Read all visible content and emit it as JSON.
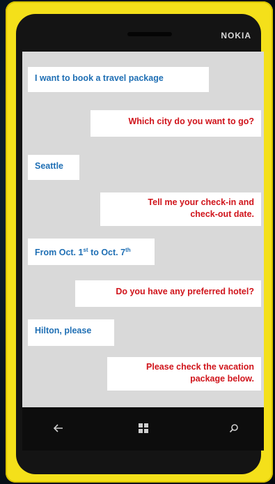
{
  "phone": {
    "brand": "NOKIA"
  },
  "chat": {
    "m1": "I want to book a travel package",
    "m2": "Which city do you want to go?",
    "m3": "Seattle",
    "m4_line1": "Tell me your check-in and",
    "m4_line2": "check-out date.",
    "m5_a": "From Oct. 1",
    "m5_sup1": "st",
    "m5_b": " to Oct. 7",
    "m5_sup2": "th",
    "m6": "Do you have any preferred hotel?",
    "m7": "Hilton, please",
    "m8_line1": "Please check the vacation",
    "m8_line2": "package below."
  },
  "navbar": {
    "back_icon": "back-arrow-icon",
    "home_icon": "windows-logo-icon",
    "search_icon": "search-icon"
  },
  "colors": {
    "phone_body": "#f4e01a",
    "user_text": "#1f6fb4",
    "bot_text": "#d0141b",
    "screen_bg": "#d9d9d9"
  }
}
